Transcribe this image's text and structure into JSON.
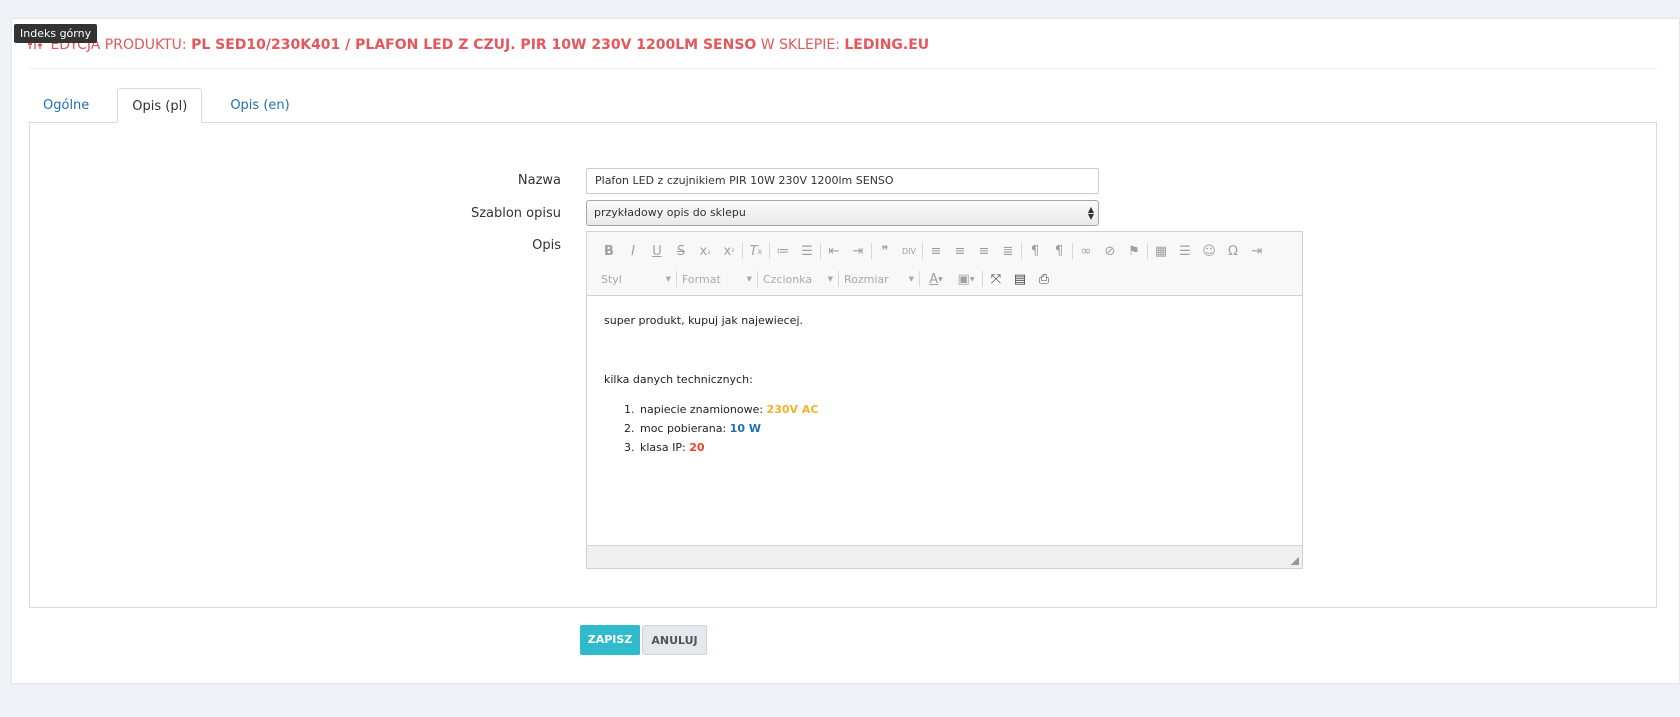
{
  "tooltip": "Indeks górny",
  "header": {
    "prefix": "EDYCJA PRODUKTU:",
    "product": "PL SED10/230K401 / PLAFON LED Z CZUJ. PIR 10W 230V 1200LM SENSO",
    "shop_prefix": "W SKLEPIE:",
    "shop": "LEDING.EU",
    "icon": "sliders-icon",
    "color": "#e4575b"
  },
  "tabs": [
    {
      "label": "Ogólne",
      "active": false
    },
    {
      "label": "Opis (pl)",
      "active": true
    },
    {
      "label": "Opis (en)",
      "active": false
    }
  ],
  "form": {
    "name_label": "Nazwa",
    "name_value": "Plafon LED z czujnikiem PIR 10W 230V 1200lm SENSO",
    "template_label": "Szablon opisu",
    "template_value": "przykładowy opis do sklepu",
    "desc_label": "Opis"
  },
  "toolbar": {
    "row1": [
      "bold-icon",
      "italic-icon",
      "underline-icon",
      "strikethrough-icon",
      "subscript-icon",
      "superscript-icon",
      "|",
      "remove-format-icon",
      "|",
      "numbered-list-icon",
      "bulleted-list-icon",
      "|",
      "outdent-icon",
      "indent-icon",
      "|",
      "blockquote-icon",
      "div-icon",
      "|",
      "align-left-icon",
      "align-center-icon",
      "align-right-icon",
      "justify-icon",
      "|",
      "ltr-icon",
      "rtl-icon",
      "|",
      "link-icon",
      "unlink-icon",
      "anchor-icon",
      "|",
      "table-icon",
      "horizontal-rule-icon",
      "smiley-icon",
      "special-char-icon",
      "page-break-icon"
    ],
    "combos": [
      {
        "label": "Styl"
      },
      {
        "label": "Format"
      },
      {
        "label": "Czcionka"
      },
      {
        "label": "Rozmiar"
      }
    ],
    "row2_icons": [
      "text-color-icon",
      "background-color-icon",
      "maximize-icon",
      "show-blocks-icon",
      "preview-icon"
    ]
  },
  "content": {
    "line1": "super produkt, kupuj jak najewiecej.",
    "line2": "kilka danych technicznych:",
    "items": [
      {
        "label": "napiecie znamionowe: ",
        "value": "230V AC",
        "color": "#f0b429"
      },
      {
        "label": "moc pobierana: ",
        "value": "10 W",
        "color": "#1f6fb2"
      },
      {
        "label": "klasa IP: ",
        "value": "20",
        "color": "#e4422b"
      }
    ]
  },
  "buttons": {
    "save": "ZAPISZ",
    "cancel": "ANULUJ"
  }
}
